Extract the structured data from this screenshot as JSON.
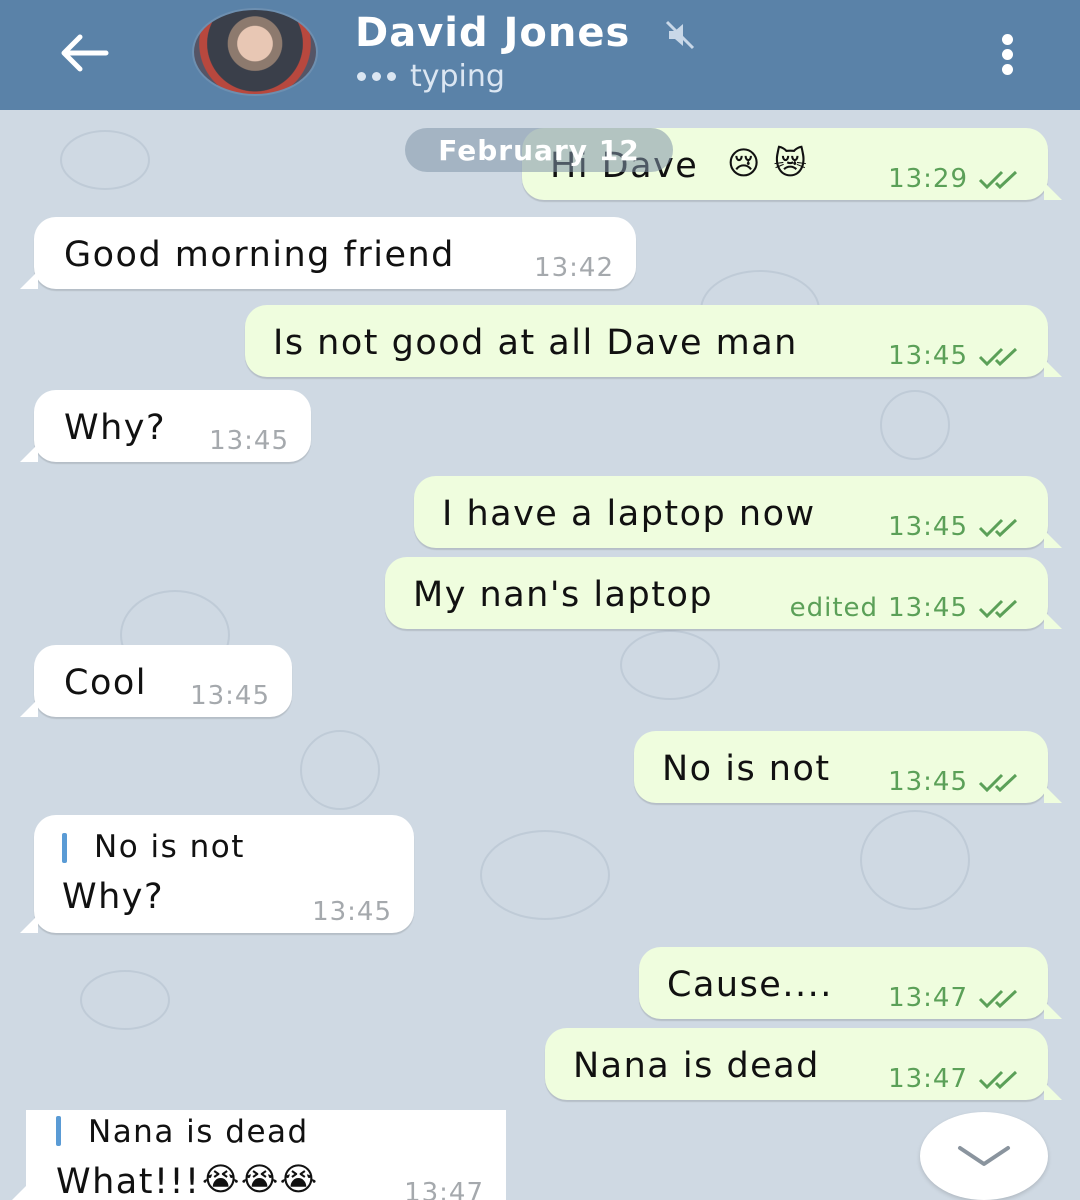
{
  "header": {
    "contact_name": "David Jones",
    "status": "typing",
    "back_icon": "arrow-left-icon",
    "mute_icon": "muted-speaker-icon",
    "menu_icon": "more-vertical-icon"
  },
  "date_separator": "February 12",
  "messages": [
    {
      "direction": "out",
      "text": "Hi Dave",
      "emoji": "😢 😿",
      "time": "13:29",
      "read": true
    },
    {
      "direction": "in",
      "text": "Good morning friend",
      "time": "13:42"
    },
    {
      "direction": "out",
      "text": "Is not good at all Dave man",
      "time": "13:45",
      "read": true
    },
    {
      "direction": "in",
      "text": "Why?",
      "time": "13:45"
    },
    {
      "direction": "out",
      "text": "I have a laptop now",
      "time": "13:45",
      "read": true
    },
    {
      "direction": "out",
      "text": "My nan's laptop",
      "edited_label": "edited",
      "time": "13:45",
      "read": true
    },
    {
      "direction": "in",
      "text": "Cool",
      "time": "13:45"
    },
    {
      "direction": "out",
      "text": "No is not",
      "time": "13:45",
      "read": true
    },
    {
      "direction": "in",
      "reply_to": "No is not",
      "text": "Why?",
      "time": "13:45"
    },
    {
      "direction": "out",
      "text": "Cause....",
      "time": "13:47",
      "read": true
    },
    {
      "direction": "out",
      "text": "Nana is dead",
      "time": "13:47",
      "read": true
    },
    {
      "direction": "in",
      "reply_to": "Nana is dead",
      "text": "What!!!",
      "emoji": "😭😭😭",
      "time": "13:47"
    }
  ],
  "colors": {
    "header": "#5a82a8",
    "chat_background": "#cfd9e3",
    "outgoing_bubble": "#effdde",
    "incoming_bubble": "#ffffff",
    "outgoing_meta": "#5ba058",
    "reply_bar": "#5a9bd5"
  },
  "scroll_down_icon": "chevron-down-icon"
}
